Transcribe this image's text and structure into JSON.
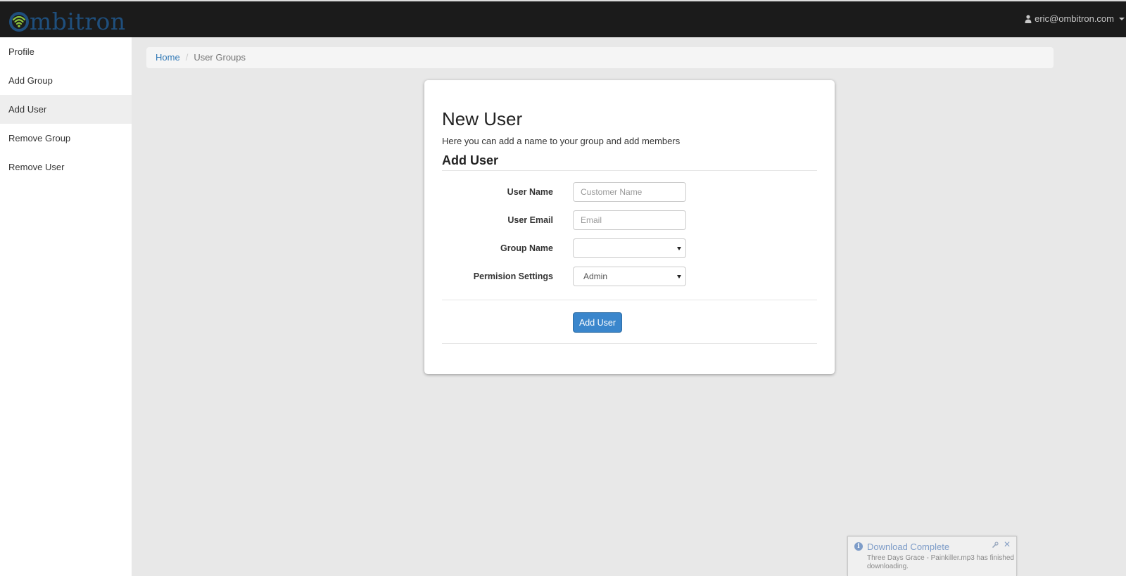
{
  "navbar": {
    "brand_text": "mbitron",
    "user_email": "eric@ombitron.com"
  },
  "sidebar": {
    "items": [
      {
        "label": "Profile"
      },
      {
        "label": "Add Group"
      },
      {
        "label": "Add User",
        "active": true
      },
      {
        "label": "Remove Group"
      },
      {
        "label": "Remove User"
      }
    ]
  },
  "breadcrumb": {
    "home": "Home",
    "separator": "/",
    "current": "User Groups"
  },
  "card": {
    "title": "New User",
    "description": "Here you can add a name to your group and add members",
    "subtitle": "Add User",
    "fields": {
      "user_name": {
        "label": "User Name",
        "placeholder": "Customer Name",
        "value": ""
      },
      "user_email": {
        "label": "User Email",
        "placeholder": "Email",
        "value": ""
      },
      "group_name": {
        "label": "Group Name",
        "selected": ""
      },
      "permission": {
        "label": "Permision Settings",
        "selected": "Admin"
      }
    },
    "submit_label": "Add User"
  },
  "notification": {
    "title": "Download Complete",
    "message": "Three Days Grace - Painkiller.mp3 has finished downloading.",
    "close_glyph": "✕"
  },
  "colors": {
    "navbar": "#1b1b1b",
    "brand": "#1f4f7d",
    "wifi_green": "#8cc63f",
    "primary": "#3a86cc",
    "link": "#337ab7"
  }
}
